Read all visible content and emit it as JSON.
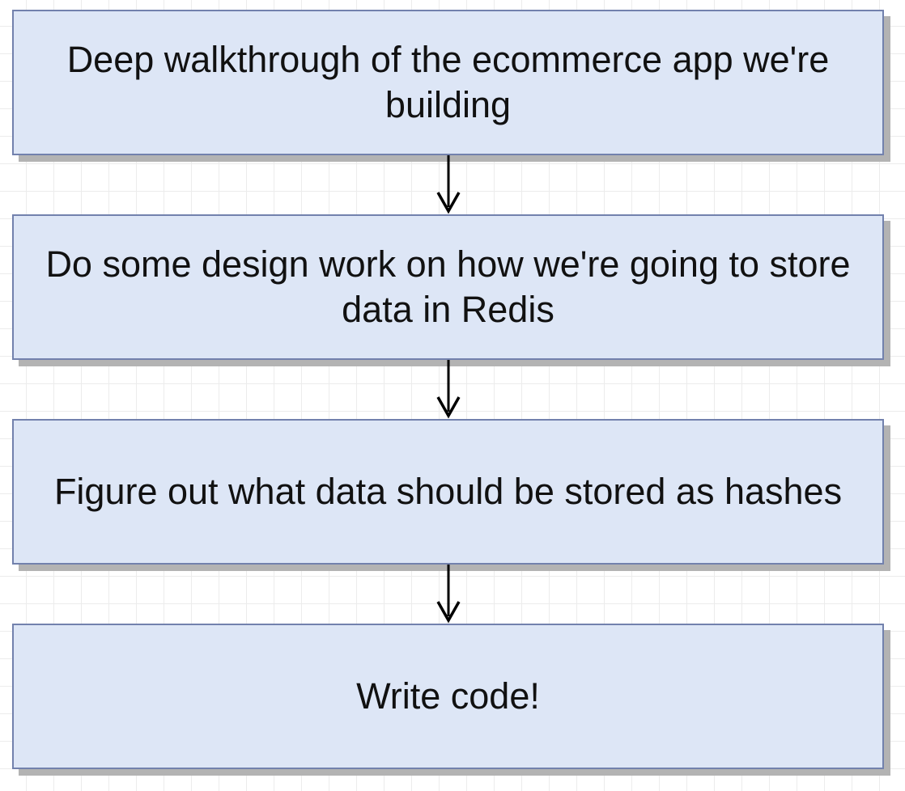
{
  "steps": [
    {
      "label": "Deep walkthrough of the ecommerce app we're building"
    },
    {
      "label": "Do some design work on how we're going to store data in Redis"
    },
    {
      "label": "Figure out what data should be stored as hashes"
    },
    {
      "label": "Write code!"
    }
  ],
  "colors": {
    "box_fill": "#dde6f6",
    "box_border": "#7281ad",
    "box_shadow": "#b3b3b3",
    "arrow": "#000000",
    "text": "#111111"
  }
}
